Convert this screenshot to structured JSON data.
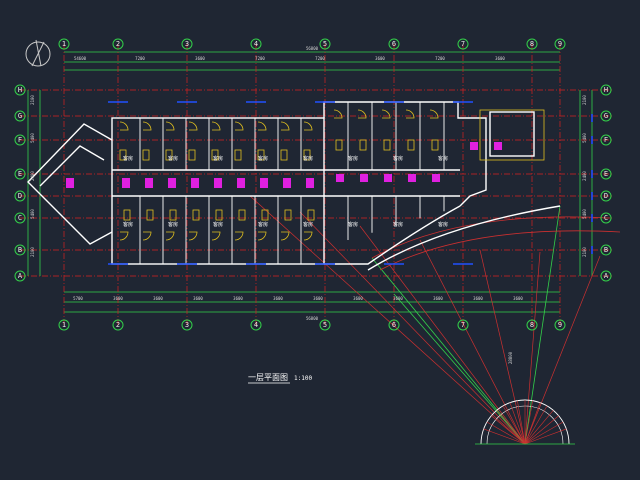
{
  "drawing": {
    "title": "一层平面图",
    "scale": "1:100",
    "background": "#1f2633",
    "colors": {
      "grid": "#d62020",
      "dimension": "#33d04a",
      "wall": "#ffffff",
      "door": "#e0c020",
      "fixture": "#e020e0",
      "window": "#2050ff",
      "arc": "#cc3030"
    },
    "north_symbol": "north-arrow-icon"
  },
  "axes": {
    "horizontal": [
      "1",
      "2",
      "3",
      "4",
      "5",
      "6",
      "7",
      "8",
      "9"
    ],
    "vertical": [
      "H",
      "G",
      "F",
      "E",
      "D",
      "C",
      "B",
      "A"
    ]
  },
  "dimensions": {
    "overall": "56800",
    "segments_top": [
      "54600",
      "7200",
      "3600",
      "7200",
      "7200",
      "3600",
      "7200",
      "3600"
    ],
    "segments_bottom": [
      "5700",
      "3600",
      "3600",
      "3600",
      "3600",
      "3600",
      "3600",
      "3600",
      "3600",
      "3600",
      "3600",
      "3600"
    ],
    "left_side": [
      "2100",
      "5400",
      "2400",
      "5400",
      "2100"
    ],
    "right_side": [
      "2100",
      "5400",
      "2400",
      "5400",
      "2100"
    ],
    "radius": "28800"
  },
  "rooms": [
    "客房",
    "客房",
    "客房",
    "客房",
    "客房",
    "客房",
    "客房",
    "客房",
    "客房",
    "客房",
    "客房",
    "客房",
    "客房",
    "客房",
    "客房",
    "客房"
  ]
}
